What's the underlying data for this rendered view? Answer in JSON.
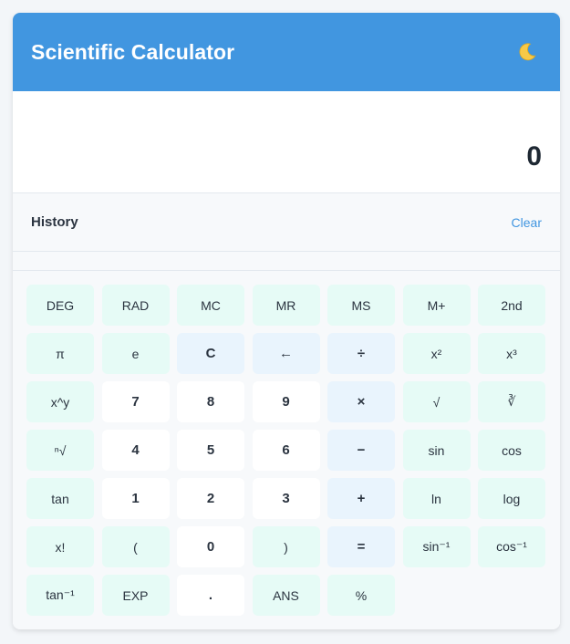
{
  "header": {
    "title": "Scientific Calculator",
    "theme_icon": "moon-icon"
  },
  "display": {
    "value": "0"
  },
  "history": {
    "title": "History",
    "clear_label": "Clear"
  },
  "colors": {
    "header": "#4196e0",
    "function_key": "#e6fbf6",
    "number_key": "#ffffff",
    "operator_key": "#e9f4fd",
    "accent": "#4196e0"
  },
  "keys": [
    {
      "id": "deg",
      "label": "DEG",
      "type": "fn"
    },
    {
      "id": "rad",
      "label": "RAD",
      "type": "fn"
    },
    {
      "id": "mc",
      "label": "MC",
      "type": "fn"
    },
    {
      "id": "mr",
      "label": "MR",
      "type": "fn"
    },
    {
      "id": "ms",
      "label": "MS",
      "type": "fn"
    },
    {
      "id": "m-plus",
      "label": "M+",
      "type": "fn"
    },
    {
      "id": "second",
      "label": "2nd",
      "type": "fn"
    },
    {
      "id": "pi",
      "label": "π",
      "type": "fn"
    },
    {
      "id": "e",
      "label": "e",
      "type": "fn"
    },
    {
      "id": "clear",
      "label": "C",
      "type": "op"
    },
    {
      "id": "backspace",
      "label": "←",
      "type": "op"
    },
    {
      "id": "divide",
      "label": "÷",
      "type": "op"
    },
    {
      "id": "square",
      "label": "x²",
      "type": "fn"
    },
    {
      "id": "cube",
      "label": "x³",
      "type": "fn"
    },
    {
      "id": "power",
      "label": "x^y",
      "type": "fn"
    },
    {
      "id": "seven",
      "label": "7",
      "type": "num"
    },
    {
      "id": "eight",
      "label": "8",
      "type": "num"
    },
    {
      "id": "nine",
      "label": "9",
      "type": "num"
    },
    {
      "id": "multiply",
      "label": "×",
      "type": "op"
    },
    {
      "id": "sqrt",
      "label": "√",
      "type": "fn"
    },
    {
      "id": "cbrt",
      "label": "∛",
      "type": "fn"
    },
    {
      "id": "nth-root",
      "label": "ⁿ√",
      "type": "fn"
    },
    {
      "id": "four",
      "label": "4",
      "type": "num"
    },
    {
      "id": "five",
      "label": "5",
      "type": "num"
    },
    {
      "id": "six",
      "label": "6",
      "type": "num"
    },
    {
      "id": "subtract",
      "label": "−",
      "type": "op"
    },
    {
      "id": "sin",
      "label": "sin",
      "type": "fn"
    },
    {
      "id": "cos",
      "label": "cos",
      "type": "fn"
    },
    {
      "id": "tan",
      "label": "tan",
      "type": "fn"
    },
    {
      "id": "one",
      "label": "1",
      "type": "num"
    },
    {
      "id": "two",
      "label": "2",
      "type": "num"
    },
    {
      "id": "three",
      "label": "3",
      "type": "num"
    },
    {
      "id": "add",
      "label": "+",
      "type": "op"
    },
    {
      "id": "ln",
      "label": "ln",
      "type": "fn"
    },
    {
      "id": "log",
      "label": "log",
      "type": "fn"
    },
    {
      "id": "factorial",
      "label": "x!",
      "type": "fn"
    },
    {
      "id": "open-paren",
      "label": "(",
      "type": "fn"
    },
    {
      "id": "zero",
      "label": "0",
      "type": "num"
    },
    {
      "id": "close-paren",
      "label": ")",
      "type": "fn"
    },
    {
      "id": "equals",
      "label": "=",
      "type": "op"
    },
    {
      "id": "asin",
      "label": "sin⁻¹",
      "type": "fn"
    },
    {
      "id": "acos",
      "label": "cos⁻¹",
      "type": "fn"
    },
    {
      "id": "atan",
      "label": "tan⁻¹",
      "type": "fn"
    },
    {
      "id": "exp",
      "label": "EXP",
      "type": "fn"
    },
    {
      "id": "decimal",
      "label": ".",
      "type": "num"
    },
    {
      "id": "ans",
      "label": "ANS",
      "type": "fn"
    },
    {
      "id": "percent",
      "label": "%",
      "type": "fn"
    }
  ]
}
